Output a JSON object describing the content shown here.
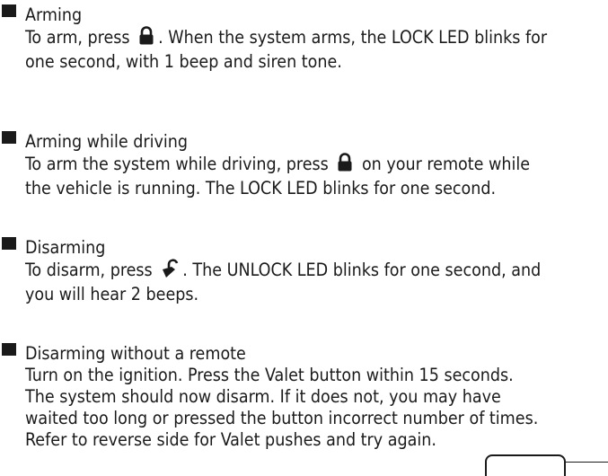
{
  "sections": [
    {
      "heading": "Arming",
      "line1_pre": "To arm, press",
      "line1_post": ". When the system arms, the LOCK LED blinks for",
      "line2": "one second, with 1 beep and siren tone.",
      "icon": "lock-icon"
    },
    {
      "heading": "Arming while driving",
      "line1_pre": "To arm the system while driving, press",
      "line1_post": "on your remote while",
      "line2": "the vehicle is running. The LOCK LED blinks for one second.",
      "icon": "lock-icon"
    },
    {
      "heading": "Disarming",
      "line1_pre": "To disarm, press",
      "line1_post": ". The UNLOCK LED blinks for one second, and",
      "line2": "you will hear 2 beeps.",
      "icon": "unlock-icon"
    },
    {
      "heading": "Disarming without a remote",
      "lines": [
        "Turn on the ignition. Press the Valet button within 15 seconds.",
        "The system should now disarm. If it does not, you may have",
        "waited too long or pressed the button incorrect number of times.",
        "Refer to reverse side for Valet pushes and try again."
      ]
    }
  ]
}
